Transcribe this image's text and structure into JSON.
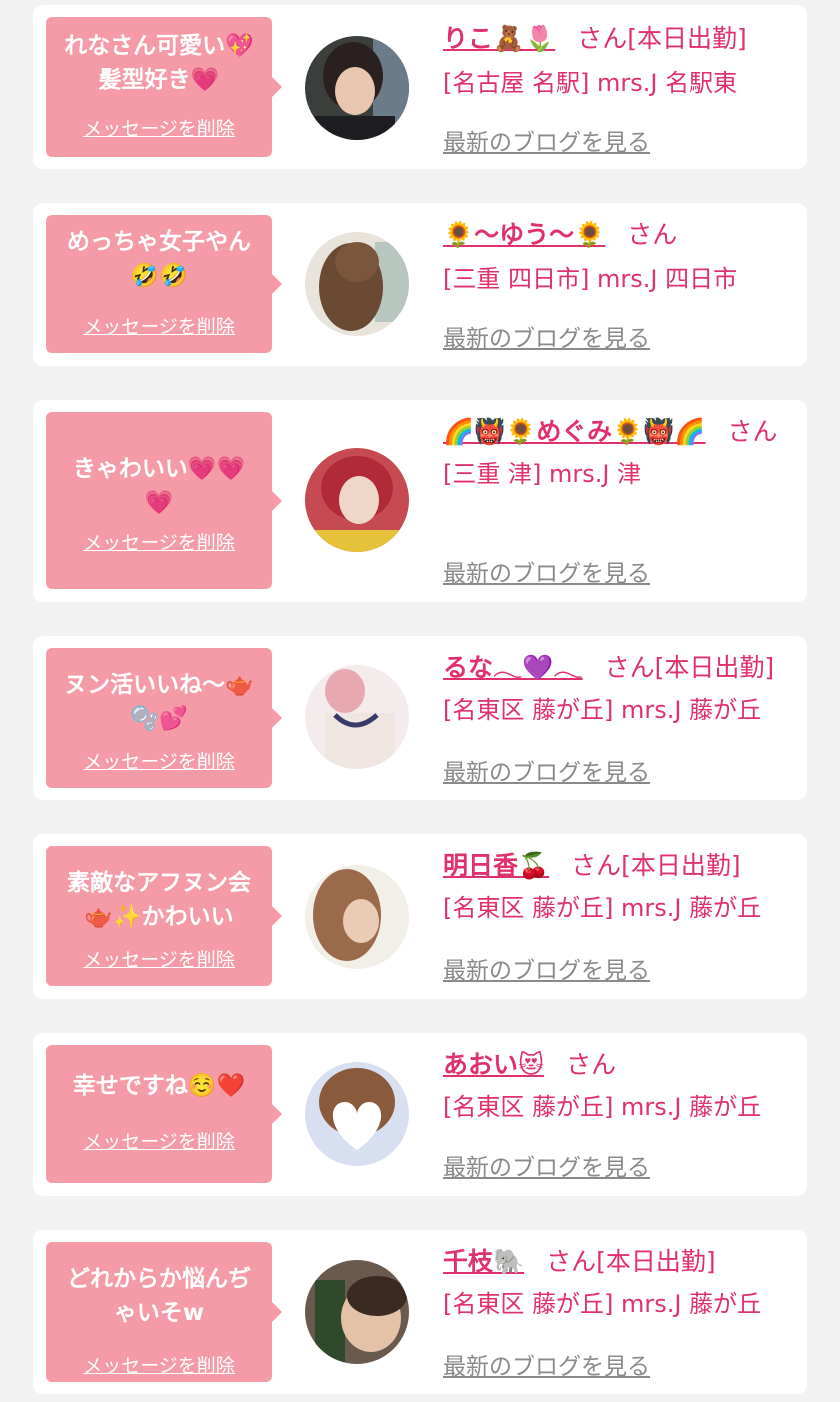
{
  "items": [
    {
      "message": "れなさん可愛い💖\n髪型好き💗",
      "delete_label": "メッセージを削除",
      "name": "りこ🧸🌷",
      "suffix": "さん[本日出勤]",
      "shop": "[名古屋 名駅] mrs.J 名駅東",
      "blog_label": "最新のブログを見る"
    },
    {
      "message": "めっちゃ女子やん\n🤣🤣",
      "delete_label": "メッセージを削除",
      "name": "🌻〜ゆう〜🌻",
      "suffix": "さん",
      "shop": "[三重 四日市] mrs.J 四日市",
      "blog_label": "最新のブログを見る"
    },
    {
      "message": "きゃわいい💗💗\n💗",
      "delete_label": "メッセージを削除",
      "name": "🌈👹🌻めぐみ🌻👹🌈",
      "suffix": "さん",
      "shop": "[三重 津] mrs.J 津",
      "blog_label": "最新のブログを見る"
    },
    {
      "message": "ヌン活いいね〜🫖\n🫧💕",
      "delete_label": "メッセージを削除",
      "name": "るな𓂃💜𓂃",
      "suffix": "さん[本日出勤]",
      "shop": "[名東区 藤が丘] mrs.J 藤が丘",
      "blog_label": "最新のブログを見る"
    },
    {
      "message": "素敵なアフヌン会\n🫖✨かわいい",
      "delete_label": "メッセージを削除",
      "name": "明日香🍒",
      "suffix": "さん[本日出勤]",
      "shop": "[名東区 藤が丘] mrs.J 藤が丘",
      "blog_label": "最新のブログを見る"
    },
    {
      "message": "幸せですね☺️❤️",
      "delete_label": "メッセージを削除",
      "name": "あおい😻",
      "suffix": "さん",
      "shop": "[名東区 藤が丘] mrs.J 藤が丘",
      "blog_label": "最新のブログを見る"
    },
    {
      "message": "どれからか悩んぢ\nゃいそw",
      "delete_label": "メッセージを削除",
      "name": "千枝🐘",
      "suffix": "さん[本日出勤]",
      "shop": "[名東区 藤が丘] mrs.J 藤が丘",
      "blog_label": "最新のブログを見る"
    }
  ],
  "colors": {
    "accent_pink": "#e0306e",
    "bubble_pink": "#f59aa7",
    "link_gray": "#8a8a8a",
    "background": "#f2f2f2"
  }
}
